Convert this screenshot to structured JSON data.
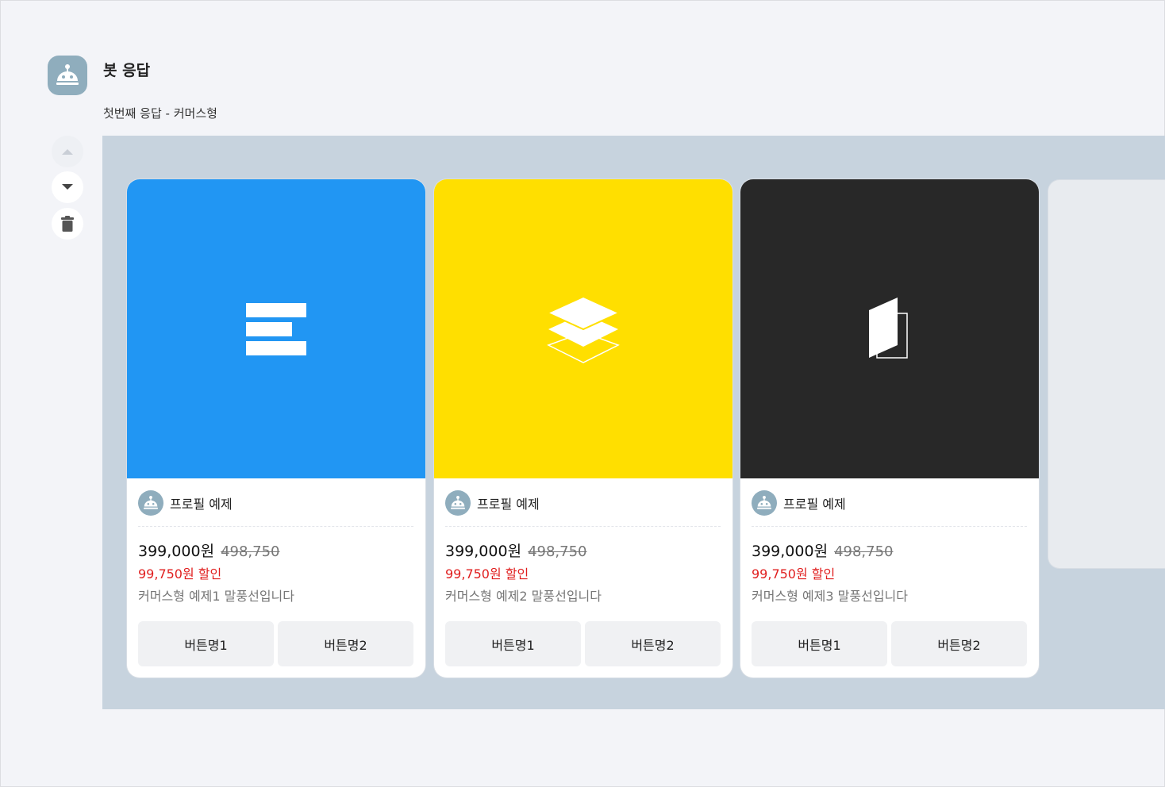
{
  "bot": {
    "name": "봇 응답",
    "avatar_icon": "robot-icon"
  },
  "response": {
    "title": "첫번째 응답 - 커머스형"
  },
  "controls": {
    "up_icon": "caret-up-icon",
    "down_icon": "caret-down-icon",
    "delete_icon": "trash-icon"
  },
  "colors": {
    "card1_bg": "#2196f3",
    "card2_bg": "#ffdf00",
    "card3_bg": "#282828",
    "discount": "#e01e1e",
    "panel_bg": "#c7d3de"
  },
  "cards": [
    {
      "image_icon": "stacked-bars-icon",
      "profile_name": "프로필 예제",
      "price": "399,000원",
      "original_price": "498,750",
      "discount": "99,750원 할인",
      "description": "커머스형 예제1 말풍선입니다",
      "button1": "버튼명1",
      "button2": "버튼명2"
    },
    {
      "image_icon": "layers-icon",
      "profile_name": "프로필 예제",
      "price": "399,000원",
      "original_price": "498,750",
      "discount": "99,750원 할인",
      "description": "커머스형 예제2 말풍선입니다",
      "button1": "버튼명1",
      "button2": "버튼명2"
    },
    {
      "image_icon": "folded-page-icon",
      "profile_name": "프로필 예제",
      "price": "399,000원",
      "original_price": "498,750",
      "discount": "99,750원 할인",
      "description": "커머스형 예제3 말풍선입니다",
      "button1": "버튼명1",
      "button2": "버튼명2"
    }
  ]
}
